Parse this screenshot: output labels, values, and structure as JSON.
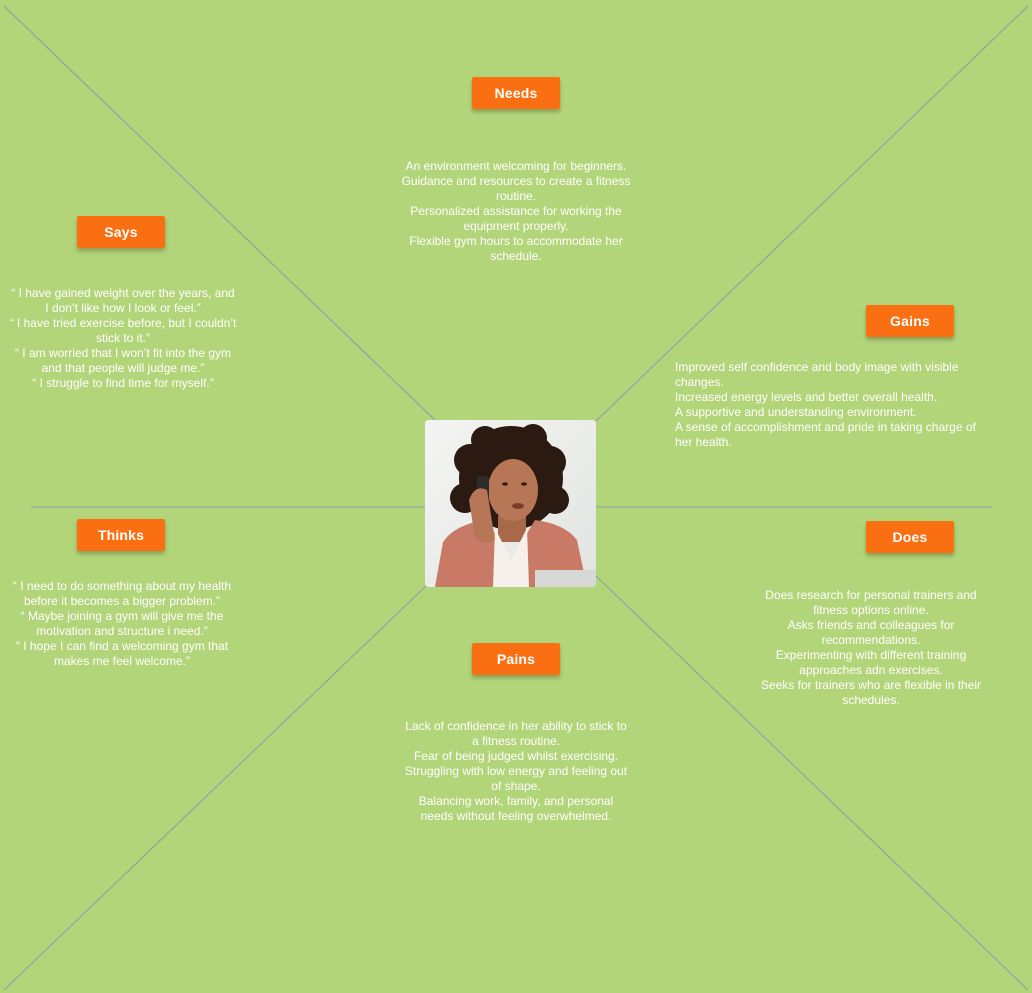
{
  "colors": {
    "background": "#b3d57a",
    "tag": "#fb6f13",
    "line": "#8a9aa8",
    "text": "#ffffff"
  },
  "persona": {
    "image": "woman-on-phone-photo"
  },
  "quadrants": {
    "needs": {
      "label": "Needs",
      "lines": [
        "An environment welcoming for beginners.",
        "Guidance and resources to create a fitness",
        "routine.",
        "Personalized assistance for working the",
        "equipment properly.",
        "Flexible gym hours to accommodate her",
        "schedule."
      ]
    },
    "says": {
      "label": "Says",
      "lines": [
        "“ I have gained weight over the years, and",
        "I don’t like how I look or feel.”",
        "“ I have tried exercise before, but I couldn’t",
        "stick to it.”",
        "“ I am worried that I won’t fit into the gym",
        "and that people will judge me.”",
        "“ I struggle to find time for myself.”"
      ]
    },
    "gains": {
      "label": "Gains",
      "lines": [
        "Improved self confidence and body image with visible",
        "changes.",
        "Increased energy levels and better overall health.",
        "A supportive and understanding environment.",
        "A sense of accomplishment and pride in taking charge of",
        "her health."
      ]
    },
    "thinks": {
      "label": "Thinks",
      "lines": [
        "“ I need to do something about my health",
        "before it becomes a bigger problem.”",
        "“ Maybe joining a gym will give me the",
        "motivation and structure i need.”",
        "“ I hope I can find a welcoming gym that",
        "makes me feel welcome.”"
      ]
    },
    "does": {
      "label": "Does",
      "lines": [
        "Does research for personal trainers and",
        "fitness options online.",
        "Asks friends and colleagues for",
        "recommendations.",
        "Experimenting with different training",
        "approaches adn exercises.",
        "Seeks for trainers who are flexible in their",
        "schedules."
      ]
    },
    "pains": {
      "label": "Pains",
      "lines": [
        "Lack of confidence in her ability to stick to",
        "a fitness routine.",
        "Fear of being judged whilst exercising.",
        "Struggling with low energy and feeling out",
        "of shape.",
        "Balancing work, family, and personal",
        "needs without feeling overwhelmed."
      ]
    }
  }
}
